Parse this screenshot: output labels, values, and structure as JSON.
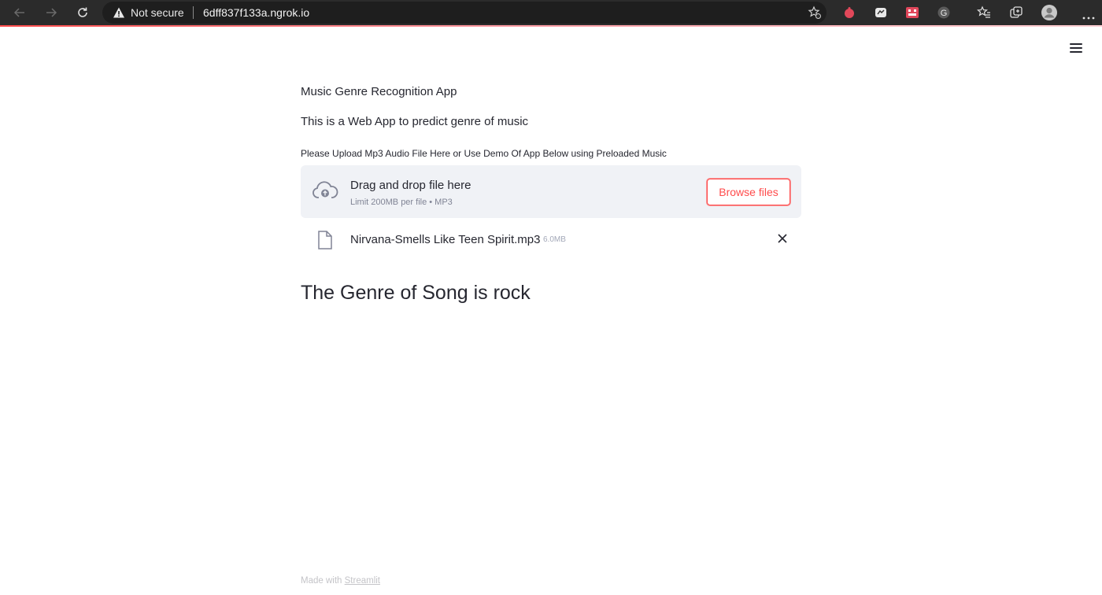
{
  "browser": {
    "security_label": "Not secure",
    "url": "6dff837f133a.ngrok.io",
    "icons": [
      "back-arrow-icon",
      "forward-arrow-icon",
      "reload-icon",
      "warning-icon",
      "favorite-add-icon",
      "extension-icon",
      "collections-icon",
      "profile-avatar-icon"
    ],
    "accent_color": "#ff4b4b"
  },
  "app": {
    "title": "Music Genre Recognition App",
    "description": "This is a Web App to predict genre of music",
    "uploader": {
      "label": "Please Upload Mp3 Audio File Here or Use Demo Of App Below using Preloaded Music",
      "drop_title": "Drag and drop file here",
      "limit": "Limit 200MB per file • MP3",
      "browse_label": "Browse files"
    },
    "file": {
      "name": "Nirvana-Smells Like Teen Spirit.mp3",
      "size": "6.0MB"
    },
    "result": "The Genre of Song is rock",
    "footer": {
      "prefix": "Made with",
      "link": "Streamlit"
    }
  }
}
